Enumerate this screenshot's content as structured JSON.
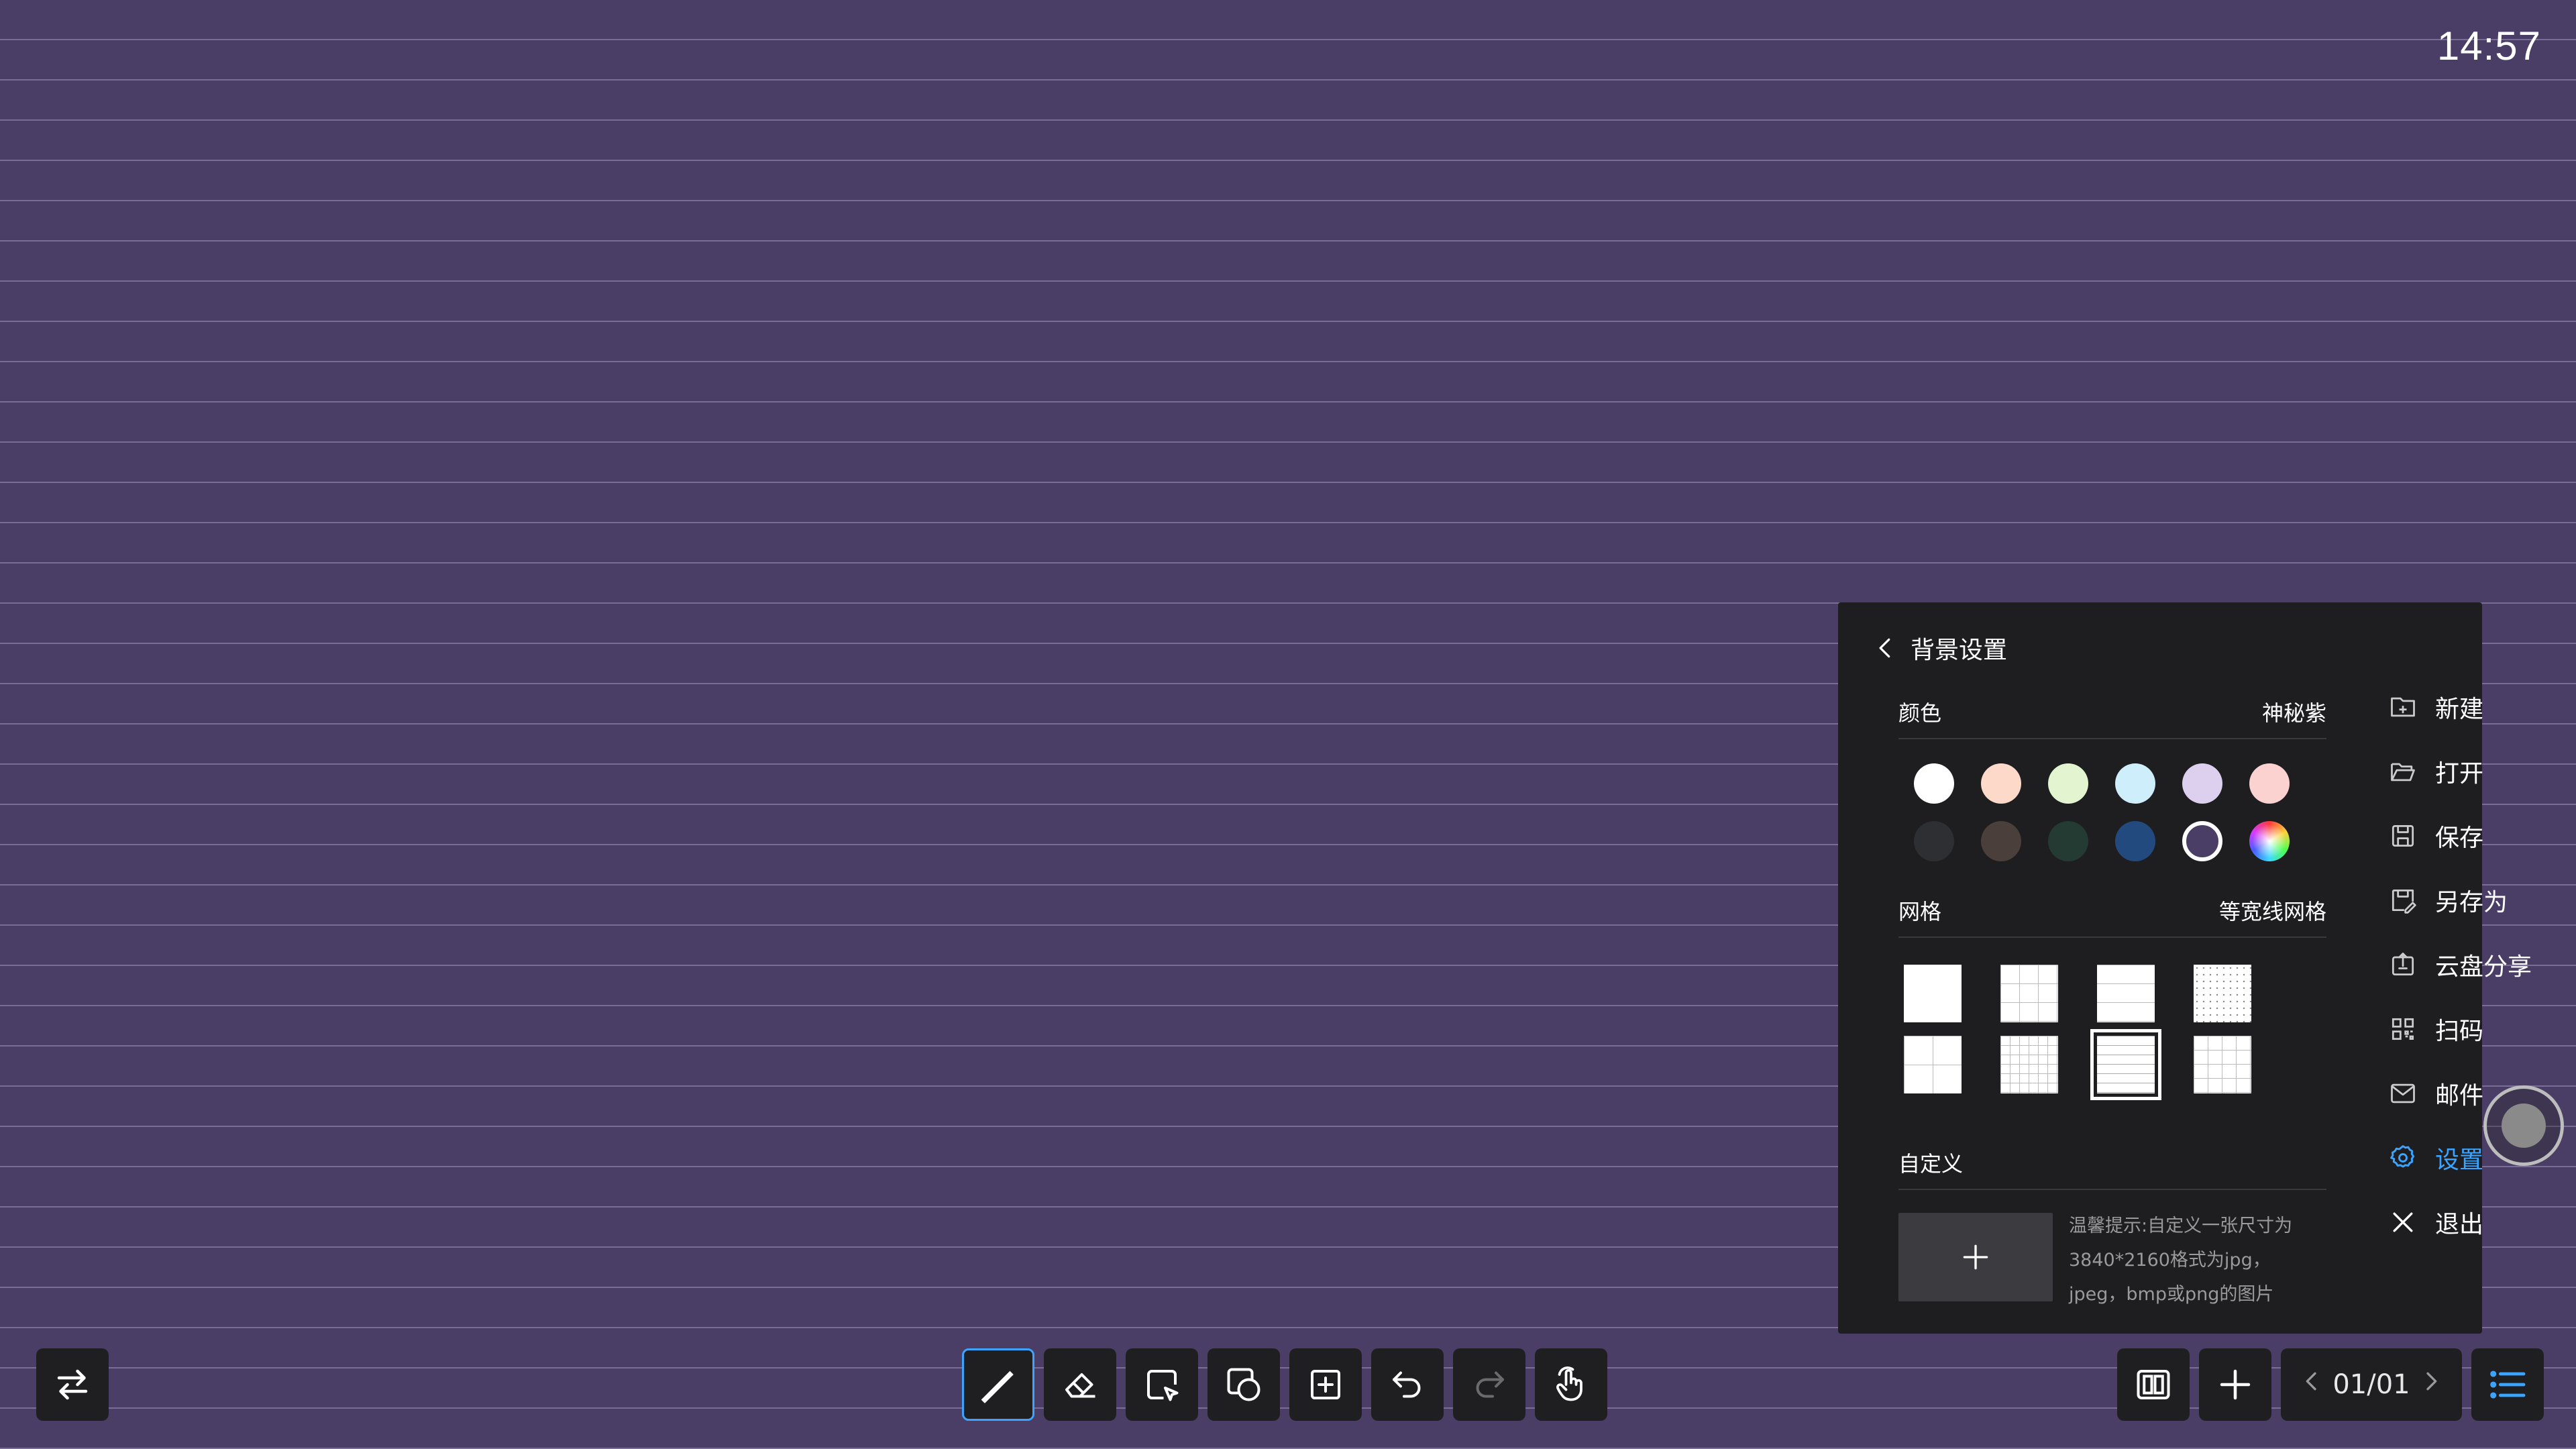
{
  "clock": "14:57",
  "toolbar": {
    "tools": [
      {
        "name": "pen-tool",
        "icon": "pen-icon",
        "active": true
      },
      {
        "name": "eraser-tool",
        "icon": "eraser-icon"
      },
      {
        "name": "select-tool",
        "icon": "select-icon"
      },
      {
        "name": "shape-tool",
        "icon": "shape-icon"
      },
      {
        "name": "insert-tool",
        "icon": "insert-icon"
      },
      {
        "name": "undo-tool",
        "icon": "undo-icon"
      },
      {
        "name": "redo-tool",
        "icon": "redo-icon"
      },
      {
        "name": "touch-tool",
        "icon": "hand-icon"
      }
    ]
  },
  "pager": {
    "label": "01/01"
  },
  "panel": {
    "title": "背景设置",
    "color_section": {
      "label": "颜色",
      "value": "神秘紫"
    },
    "colors": [
      "#ffffff",
      "#fcd9c8",
      "#e2f5d0",
      "#cfeefb",
      "#ddd0ee",
      "#fcd2d0",
      "#2e2f33",
      "#4a3f3a",
      "#243b33",
      "#234a7e",
      "#4a3e66",
      "rainbow"
    ],
    "selected_color_index": 10,
    "grid_section": {
      "label": "网格",
      "value": "等宽线网格"
    },
    "selected_grid_index": 6,
    "custom_section": {
      "label": "自定义"
    },
    "hint": "温馨提示:自定义一张尺寸为3840*2160格式为jpg，jpeg，bmp或png的图片"
  },
  "menu": {
    "items": [
      {
        "label": "新建",
        "icon": "new-file-icon"
      },
      {
        "label": "打开",
        "icon": "open-folder-icon"
      },
      {
        "label": "保存",
        "icon": "save-icon"
      },
      {
        "label": "另存为",
        "icon": "save-as-icon"
      },
      {
        "label": "云盘分享",
        "icon": "cloud-share-icon"
      },
      {
        "label": "扫码",
        "icon": "qr-code-icon"
      },
      {
        "label": "邮件",
        "icon": "mail-icon"
      },
      {
        "label": "设置",
        "icon": "gear-icon",
        "active": true
      },
      {
        "label": "退出",
        "icon": "close-icon"
      }
    ]
  },
  "accent_color": "#3aa4ff",
  "background_color": "#4a3e66"
}
